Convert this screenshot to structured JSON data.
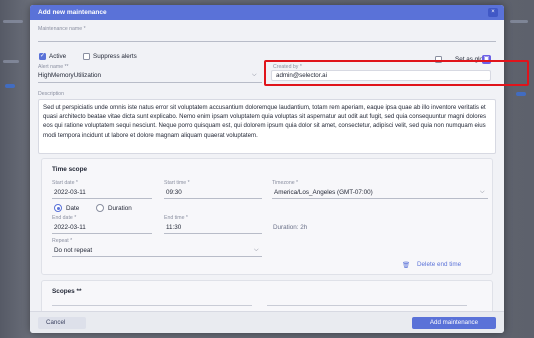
{
  "dialog": {
    "title": "Add new maintenance",
    "close_icon": "close-icon",
    "close_glyph": "×"
  },
  "form": {
    "maintenance_name_label": "Maintenance name *",
    "maintenance_name_value": "",
    "active_label": "Active",
    "active_checked": true,
    "suppress_label": "Suppress alerts",
    "suppress_checked": false,
    "set_global_label": "Set as global",
    "set_global_checked": false,
    "alert_name_label": "Alert name **",
    "alert_name_value": "HighMemoryUtilization",
    "created_by_label": "Created by *",
    "created_by_value": "admin@selector.ai",
    "description_label": "Description",
    "description_value": "Sed ut perspiciatis unde omnis iste natus error sit voluptatem accusantium doloremque laudantium, totam rem aperiam, eaque ipsa quae ab illo inventore veritatis et quasi architecto beatae vitae dicta sunt explicabo. Nemo enim ipsam voluptatem quia voluptas sit aspernatur aut odit aut fugit, sed quia consequuntur magni dolores eos qui ratione voluptatem sequi nesciunt. Neque porro quisquam est, qui dolorem ipsum quia dolor sit amet, consectetur, adipisci velit, sed quia non numquam eius modi tempora incidunt ut labore et dolore magnam aliquam quaerat voluptatem."
  },
  "time_scope": {
    "title": "Time scope",
    "start_date_label": "Start date *",
    "start_date_value": "2022-03-11",
    "start_time_label": "Start time *",
    "start_time_value": "09:30",
    "timezone_label": "Timezone *",
    "timezone_value": "America/Los_Angeles (GMT-07:00)",
    "mode_date_label": "Date",
    "mode_duration_label": "Duration",
    "mode_selected": "Date",
    "end_date_label": "End date *",
    "end_date_value": "2022-03-11",
    "end_time_label": "End time *",
    "end_time_value": "11:30",
    "duration_text": "Duration: 2h",
    "repeat_label": "Repeat *",
    "repeat_value": "Do not repeat",
    "delete_end_time_label": "Delete end time"
  },
  "scopes": {
    "title": "Scopes **"
  },
  "footer": {
    "cancel_label": "Cancel",
    "add_label": "Add maintenance"
  },
  "colors": {
    "accent": "#5a72d8",
    "highlight": "#e0141b"
  }
}
